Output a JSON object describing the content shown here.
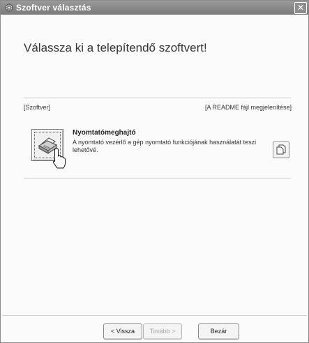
{
  "window": {
    "title": "Szoftver választás",
    "close_label": "✕"
  },
  "heading": "Válassza ki a telepítendő szoftvert!",
  "columns": {
    "software": "[Szoftver]",
    "readme": "[A README fájl megjelenítése]"
  },
  "software_items": [
    {
      "title": "Nyomtatómeghajtó",
      "description": "A nyomtató vezérlő a gép nyomtató funkciójának használatát teszi lehetővé.",
      "icon": "printer-icon",
      "readme_icon": "document-icon"
    }
  ],
  "buttons": {
    "back": "< Vissza",
    "next": "Tovább >",
    "close": "Bezár"
  }
}
